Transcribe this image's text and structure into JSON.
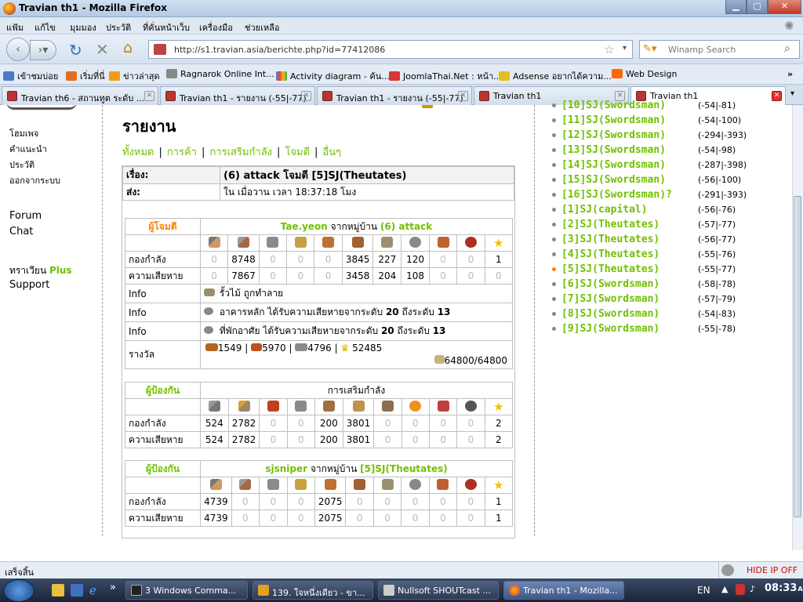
{
  "window": {
    "title": "Travian th1 - Mozilla Firefox"
  },
  "menu": [
    "แฟ้ม",
    "แก้ไข",
    "มุมมอง",
    "ประวัติ",
    "ที่คั่นหน้าเว็บ",
    "เครื่องมือ",
    "ช่วยเหลือ"
  ],
  "nav": {
    "url": "http://s1.travian.asia/berichte.php?id=77412086",
    "search_placeholder": "Winamp Search"
  },
  "bookmarks": [
    "เข้าชมบ่อย",
    "เริ่มที่นี่",
    "ข่าวล่าสุด",
    "Ragnarok Online Int...",
    "Activity diagram - ค้น...",
    "JoomlaThai.Net : หน้า...",
    "Adsense อยากได้ความ...",
    "Web Design"
  ],
  "tabs": [
    "Travian th6 - สถานทูต ระดับ ...",
    "Travian th1 - รายงาน (-55|-77)",
    "Travian th1 - รายงาน (-55|-77)",
    "Travian th1",
    "Travian th1"
  ],
  "left_menu": {
    "home": "โฮมเพจ",
    "guide": "คำแนะนำ",
    "profile": "ประวัติ",
    "logout": "ออกจากระบบ",
    "forum": "Forum",
    "chat": "Chat",
    "plus_prefix": "ทราเวียน ",
    "plus": "Plus",
    "support": "Support"
  },
  "report": {
    "heading": "รายงาน",
    "filters": [
      "ทั้งหมด",
      "การค้า",
      "การเสริมกำลัง",
      "โจมตี",
      "อื่นๆ"
    ],
    "subject_label": "เรื่อง:",
    "subject": "(6) attack โจมตี [5]SJ(Theutates)",
    "sent_label": "ส่ง:",
    "sent": "ใน เมื่อวาน เวลา 18:37:18 โมง",
    "attacker": {
      "role": "ผู้โจมตี",
      "player": "Tae.yeon",
      "from": " จากหมู่บ้าน ",
      "village": "(6) attack",
      "troops_label": "กองกำลัง",
      "troops": [
        "0",
        "8748",
        "0",
        "0",
        "0",
        "3845",
        "227",
        "120",
        "0",
        "0",
        "1"
      ],
      "losses_label": "ความเสียหาย",
      "losses": [
        "0",
        "7867",
        "0",
        "0",
        "0",
        "3458",
        "204",
        "108",
        "0",
        "0",
        "0"
      ]
    },
    "info": [
      {
        "label": "Info",
        "text": "รั้วไม้ ถูกทำลาย"
      },
      {
        "label": "Info",
        "text_pre": "อาคารหลัก ได้รับความเสียหายจากระดับ ",
        "from": "20",
        "mid": " ถึงระดับ ",
        "to": "13"
      },
      {
        "label": "Info",
        "text_pre": "ที่พักอาศัย ได้รับความเสียหายจากระดับ ",
        "from": "20",
        "mid": " ถึงระดับ ",
        "to": "13"
      }
    ],
    "bounty": {
      "label": "รางวัล",
      "wood": "1549",
      "clay": "5970",
      "iron": "4796",
      "crop": "52485",
      "carry": "64800/64800"
    },
    "defender1": {
      "role": "ผู้ป้องกัน",
      "title": "การเสริมกำลัง",
      "troops_label": "กองกำลัง",
      "troops": [
        "524",
        "2782",
        "0",
        "0",
        "200",
        "3801",
        "0",
        "0",
        "0",
        "0",
        "2"
      ],
      "losses_label": "ความเสียหาย",
      "losses": [
        "524",
        "2782",
        "0",
        "0",
        "200",
        "3801",
        "0",
        "0",
        "0",
        "0",
        "2"
      ]
    },
    "defender2": {
      "role": "ผู้ป้องกัน",
      "player": "sjsniper",
      "from": " จากหมู่บ้าน ",
      "village": "[5]SJ(Theutates)",
      "troops_label": "กองกำลัง",
      "troops": [
        "4739",
        "0",
        "0",
        "0",
        "2075",
        "0",
        "0",
        "0",
        "0",
        "0",
        "1"
      ],
      "losses_label": "ความเสียหาย",
      "losses": [
        "4739",
        "0",
        "0",
        "0",
        "2075",
        "0",
        "0",
        "0",
        "0",
        "0",
        "1"
      ]
    }
  },
  "villages": [
    {
      "name": "[10]SJ(Swordsman)",
      "coord": "(-54|-81)"
    },
    {
      "name": "[11]SJ(Swordsman)",
      "coord": "(-54|-100)"
    },
    {
      "name": "[12]SJ(Swordsman)",
      "coord": "(-294|-393)"
    },
    {
      "name": "[13]SJ(Swordsman)",
      "coord": "(-54|-98)"
    },
    {
      "name": "[14]SJ(Swordsman)",
      "coord": "(-287|-398)"
    },
    {
      "name": "[15]SJ(Swordsman)",
      "coord": "(-56|-100)"
    },
    {
      "name": "[16]SJ(Swordsman)?",
      "coord": "(-291|-393)"
    },
    {
      "name": "[1]SJ(capital)",
      "coord": "(-56|-76)"
    },
    {
      "name": "[2]SJ(Theutates)",
      "coord": "(-57|-77)"
    },
    {
      "name": "[3]SJ(Theutates)",
      "coord": "(-56|-77)"
    },
    {
      "name": "[4]SJ(Theutates)",
      "coord": "(-55|-76)"
    },
    {
      "name": "[5]SJ(Theutates)",
      "coord": "(-55|-77)"
    },
    {
      "name": "[6]SJ(Swordsman)",
      "coord": "(-58|-78)"
    },
    {
      "name": "[7]SJ(Swordsman)",
      "coord": "(-57|-79)"
    },
    {
      "name": "[8]SJ(Swordsman)",
      "coord": "(-54|-83)"
    },
    {
      "name": "[9]SJ(Swordsman)",
      "coord": "(-55|-78)"
    }
  ],
  "status": {
    "text": "เสร็จสิ้น",
    "hideip": "HIDE IP OFF"
  },
  "taskbar": {
    "items": [
      "3 Windows Comma...",
      "139. ใจหนึ่งเดียว - ขา...",
      "Nullsoft SHOUTcast ...",
      "Travian th1 - Mozilla..."
    ],
    "lang": "EN",
    "time": "08:33",
    "ampm": "AM"
  },
  "colors": {
    "accent_green": "#71c000",
    "accent_orange": "#ff8000"
  }
}
